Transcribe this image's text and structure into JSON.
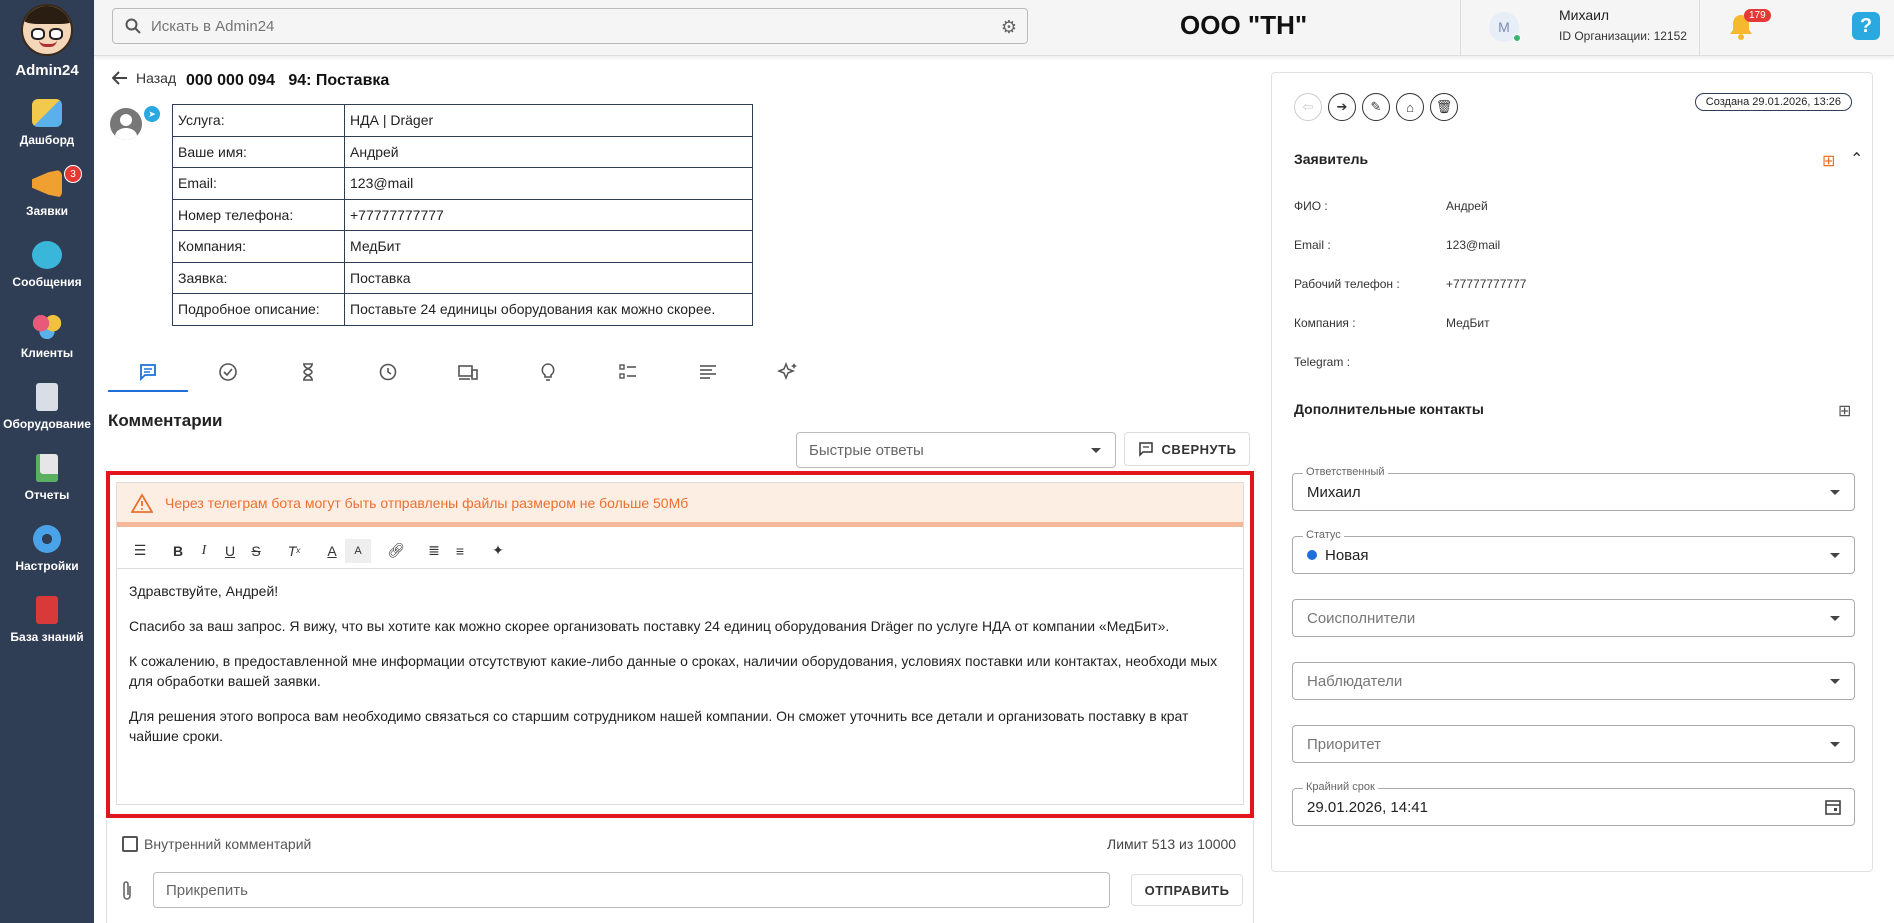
{
  "sidebar": {
    "logo_text": "Admin24",
    "items": [
      {
        "label": "Дашборд",
        "icon": "dashboard-icon",
        "color": "#e8b43a"
      },
      {
        "label": "Заявки",
        "icon": "megaphone-icon",
        "color": "#f0a030",
        "badge": "3"
      },
      {
        "label": "Сообщения",
        "icon": "chat-icon",
        "color": "#39b6d9"
      },
      {
        "label": "Клиенты",
        "icon": "clients-icon",
        "color": "#e85a7a"
      },
      {
        "label": "Оборудование",
        "icon": "equipment-icon",
        "color": "#d8dde6"
      },
      {
        "label": "Отчеты",
        "icon": "reports-icon",
        "color": "#e6e6e6"
      },
      {
        "label": "Настройки",
        "icon": "gear-icon",
        "color": "#4aa3e8"
      },
      {
        "label": "База знаний",
        "icon": "book-icon",
        "color": "#d83a3a"
      }
    ]
  },
  "topbar": {
    "search_placeholder": "Искать в Admin24",
    "org_title": "ООО \"ТН\"",
    "user": {
      "avatar_letter": "M",
      "name": "Михаил",
      "org_id": "ID Организации: 12152"
    },
    "notifications_count": "179",
    "help_label": "?"
  },
  "ticket": {
    "back_label": "Назад",
    "title": "000 000 094   94: Поставка",
    "info": [
      {
        "key": "Услуга:",
        "value": "НДА | Dräger"
      },
      {
        "key": "Ваше имя:",
        "value": "Андрей"
      },
      {
        "key": "Email:",
        "value": "123@mail"
      },
      {
        "key": "Номер телефона:",
        "value": "+77777777777"
      },
      {
        "key": "Компания:",
        "value": "МедБит"
      },
      {
        "key": "Заявка:",
        "value": "Поставка"
      },
      {
        "key": "Подробное описание:",
        "value": "Поставьте 24 единицы оборудования как можно скорее."
      }
    ]
  },
  "comments": {
    "title": "Комментарии",
    "quick_replies_placeholder": "Быстрые ответы",
    "collapse_label": "СВЕРНУТЬ",
    "alert": "Через телеграм бота могут быть отправлены файлы размером не больше 50Мб",
    "body": [
      "Здравствуйте, Андрей!",
      "Спасибо за ваш запрос. Я вижу, что вы хотите как можно скорее организовать поставку 24 единиц оборудования Dräger по услуге НДА от компании «МедБит».",
      "К сожалению, в предоставленной мне информации отсутствуют какие-либо данные о сроках, наличии оборудования, условиях поставки или контактах, необходи мых для обработки вашей заявки.",
      "Для решения этого вопроса вам необходимо связаться со старшим сотрудником нашей компании. Он сможет уточнить все детали и организовать поставку в крат чайшие сроки."
    ],
    "internal_label": "Внутренний комментарий",
    "limit": "Лимит 513 из 10000",
    "attach_placeholder": "Прикрепить",
    "send_label": "ОТПРАВИТЬ"
  },
  "right_panel": {
    "created": "Создана 29.01.2026, 13:26",
    "applicant_title": "Заявитель",
    "applicant": [
      {
        "key": "ФИО :",
        "value": "Андрей"
      },
      {
        "key": "Email :",
        "value": "123@mail"
      },
      {
        "key": "Рабочий телефон :",
        "value": "+77777777777"
      },
      {
        "key": "Компания :",
        "value": "МедБит"
      },
      {
        "key": "Telegram :",
        "value": ""
      }
    ],
    "extra_contacts_title": "Дополнительные контакты",
    "responsible": {
      "label": "Ответственный",
      "value": "Михаил"
    },
    "status": {
      "label": "Статус",
      "value": "Новая"
    },
    "coexecutors_placeholder": "Соисполнители",
    "observers_placeholder": "Наблюдатели",
    "priority_placeholder": "Приоритет",
    "deadline": {
      "label": "Крайний срок",
      "value": "29.01.2026, 14:41"
    }
  },
  "colors": {
    "sidebar": "#2f3d55",
    "accent": "#1e6fd9",
    "alert_text": "#ea7030",
    "highlight": "#e3151c"
  }
}
